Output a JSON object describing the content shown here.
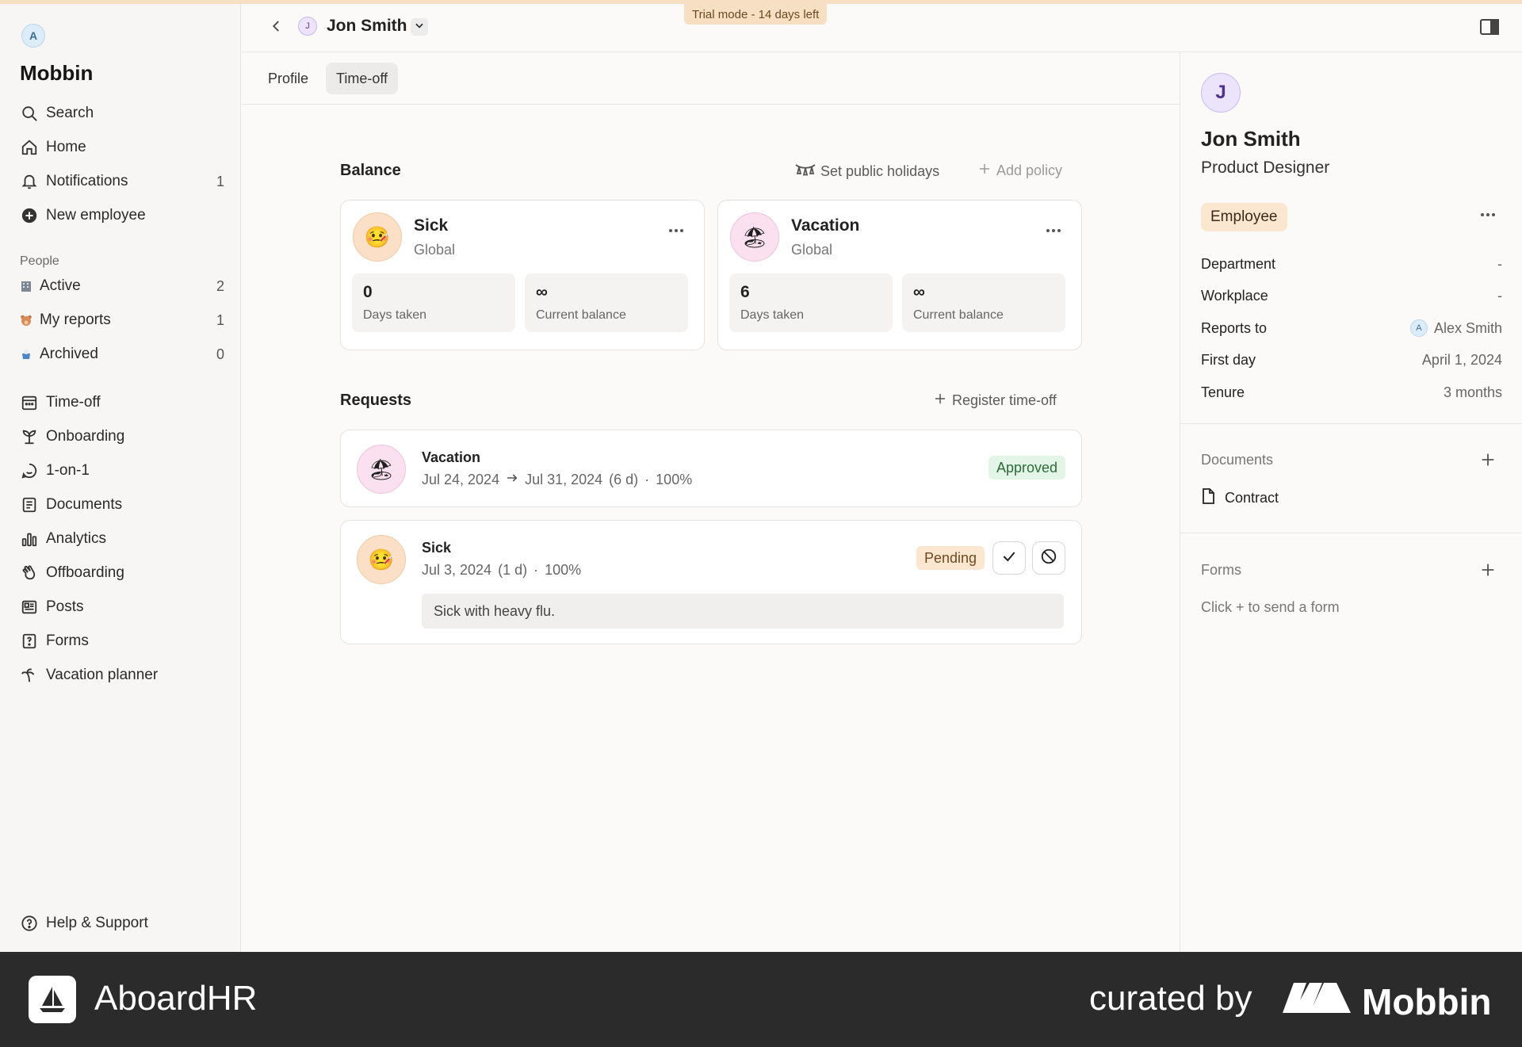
{
  "app": {
    "workspace_initial": "A",
    "workspace_name": "Mobbin",
    "trial_banner": "Trial mode - 14 days left"
  },
  "sidebar": {
    "nav_top": [
      {
        "label": "Search",
        "icon": "search-icon"
      },
      {
        "label": "Home",
        "icon": "home-icon"
      },
      {
        "label": "Notifications",
        "icon": "bell-icon",
        "count": "1"
      },
      {
        "label": "New employee",
        "icon": "plus-circle-icon"
      }
    ],
    "people_label": "People",
    "people": [
      {
        "label": "Active",
        "icon": "office-emoji-icon",
        "count": "2"
      },
      {
        "label": "My reports",
        "icon": "bear-emoji-icon",
        "count": "1"
      },
      {
        "label": "Archived",
        "icon": "archive-emoji-icon",
        "count": "0"
      }
    ],
    "nav_modules": [
      {
        "label": "Time-off",
        "icon": "calendar-icon"
      },
      {
        "label": "Onboarding",
        "icon": "sprout-icon"
      },
      {
        "label": "1-on-1",
        "icon": "chat-smile-icon"
      },
      {
        "label": "Documents",
        "icon": "document-icon"
      },
      {
        "label": "Analytics",
        "icon": "bar-chart-icon"
      },
      {
        "label": "Offboarding",
        "icon": "wave-hand-icon"
      },
      {
        "label": "Posts",
        "icon": "newspaper-icon"
      },
      {
        "label": "Forms",
        "icon": "form-icon"
      },
      {
        "label": "Vacation planner",
        "icon": "palm-tree-icon"
      }
    ],
    "help": "Help & Support"
  },
  "header": {
    "avatar_initial": "J",
    "name": "Jon Smith"
  },
  "tabs": [
    {
      "label": "Profile",
      "active": false
    },
    {
      "label": "Time-off",
      "active": true
    }
  ],
  "balance": {
    "title": "Balance",
    "set_holidays": "Set public holidays",
    "add_policy": "Add policy",
    "cards": [
      {
        "name": "Sick",
        "scope": "Global",
        "emoji": "🤒",
        "days_taken": "0",
        "days_taken_label": "Days taken",
        "current_balance": "∞",
        "current_balance_label": "Current balance"
      },
      {
        "name": "Vacation",
        "scope": "Global",
        "emoji": "🏖",
        "days_taken": "6",
        "days_taken_label": "Days taken",
        "current_balance": "∞",
        "current_balance_label": "Current balance"
      }
    ]
  },
  "requests": {
    "title": "Requests",
    "register": "Register time-off",
    "items": [
      {
        "type": "Vacation",
        "emoji": "🏖",
        "start": "Jul 24, 2024",
        "end": "Jul 31, 2024",
        "duration": "(6 d)",
        "percent": "100%",
        "status": "Approved"
      },
      {
        "type": "Sick",
        "emoji": "🤒",
        "start": "Jul 3, 2024",
        "duration": "(1 d)",
        "percent": "100%",
        "status": "Pending",
        "note": "Sick with heavy flu."
      }
    ]
  },
  "profile_panel": {
    "avatar_initial": "J",
    "name": "Jon Smith",
    "role": "Product Designer",
    "badge": "Employee",
    "fields": [
      {
        "key": "Department",
        "value": "-"
      },
      {
        "key": "Workplace",
        "value": "-"
      },
      {
        "key": "Reports to",
        "value": "Alex Smith",
        "avatar": "A"
      },
      {
        "key": "First day",
        "value": "April 1, 2024"
      },
      {
        "key": "Tenure",
        "value": "3 months"
      }
    ],
    "documents_label": "Documents",
    "document_item": "Contract",
    "forms_label": "Forms",
    "forms_hint": "Click + to send a form"
  },
  "footer": {
    "app_name": "AboardHR",
    "curated_by": "curated by",
    "brand": "Mobbin"
  }
}
